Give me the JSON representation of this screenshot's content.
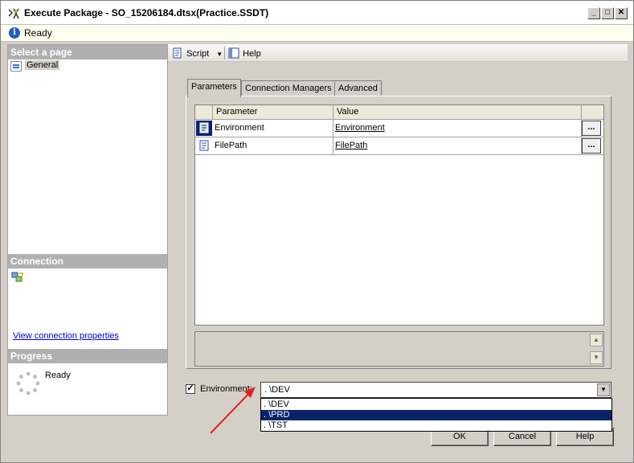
{
  "window": {
    "title": "Execute Package - SO_15206184.dtsx(Practice.SSDT)",
    "controls": [
      "minimize",
      "maximize",
      "close"
    ]
  },
  "status": {
    "icon": "info-icon",
    "text": "Ready"
  },
  "left_pane": {
    "select_page_header": "Select a page",
    "pages": [
      {
        "label": "General",
        "icon": "page-icon"
      }
    ],
    "connection_header": "Connection",
    "connection_icon": "server-connection-icon",
    "connection_link": "View connection properties",
    "progress_header": "Progress",
    "progress_icon": "spinner-icon",
    "progress_text": "Ready"
  },
  "toolbar": {
    "script_label": "Script",
    "help_label": "Help"
  },
  "tabs": [
    {
      "label": "Parameters",
      "active": true
    },
    {
      "label": "Connection Managers",
      "active": false
    },
    {
      "label": "Advanced",
      "active": false
    }
  ],
  "grid": {
    "columns": [
      "Parameter",
      "Value"
    ],
    "rows": [
      {
        "parameter": "Environment",
        "value": "Environment",
        "ellipsis": "...",
        "icon": "environment-parameter-icon",
        "selected": true
      },
      {
        "parameter": "FilePath",
        "value": "FilePath",
        "ellipsis": "...",
        "icon": "file-parameter-icon",
        "selected": false
      }
    ]
  },
  "environment": {
    "checked": true,
    "label": "Environment:",
    "value": ". \\DEV",
    "options": [
      {
        "label": ". \\DEV",
        "selected": false
      },
      {
        "label": ". \\PRD",
        "selected": true
      },
      {
        "label": ". \\TST",
        "selected": false
      }
    ]
  },
  "buttons": {
    "ok": "OK",
    "cancel": "Cancel",
    "help": "Help"
  },
  "annotation": {
    "arrow_color": "#e02020"
  },
  "colors": {
    "selection": "#0a246a",
    "link": "#0000cc",
    "section_header": "#b0b0b0"
  }
}
